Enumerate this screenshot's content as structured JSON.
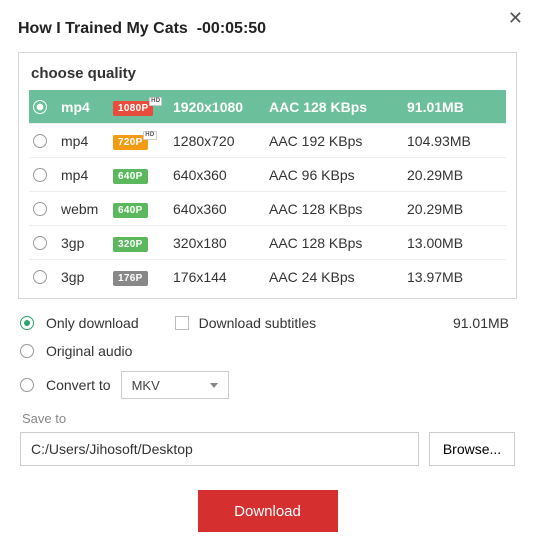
{
  "header": {
    "title": "How I Trained My Cats",
    "duration": "-00:05:50"
  },
  "quality": {
    "heading": "choose quality",
    "rows": [
      {
        "format": "mp4",
        "badge": "1080P",
        "badge_color": "red",
        "hd": true,
        "resolution": "1920x1080",
        "audio": "AAC 128 KBps",
        "size": "91.01MB",
        "selected": true
      },
      {
        "format": "mp4",
        "badge": "720P",
        "badge_color": "orange",
        "hd": true,
        "resolution": "1280x720",
        "audio": "AAC 192 KBps",
        "size": "104.93MB",
        "selected": false
      },
      {
        "format": "mp4",
        "badge": "640P",
        "badge_color": "green",
        "hd": false,
        "resolution": "640x360",
        "audio": "AAC 96 KBps",
        "size": "20.29MB",
        "selected": false
      },
      {
        "format": "webm",
        "badge": "640P",
        "badge_color": "green",
        "hd": false,
        "resolution": "640x360",
        "audio": "AAC 128 KBps",
        "size": "20.29MB",
        "selected": false
      },
      {
        "format": "3gp",
        "badge": "320P",
        "badge_color": "green",
        "hd": false,
        "resolution": "320x180",
        "audio": "AAC 128 KBps",
        "size": "13.00MB",
        "selected": false
      },
      {
        "format": "3gp",
        "badge": "176P",
        "badge_color": "gray",
        "hd": false,
        "resolution": "176x144",
        "audio": "AAC 24 KBps",
        "size": "13.97MB",
        "selected": false
      }
    ]
  },
  "options": {
    "only_download": "Only download",
    "download_subtitles": "Download subtitles",
    "selected_size": "91.01MB",
    "original_audio": "Original audio",
    "convert_to": "Convert to",
    "convert_value": "MKV"
  },
  "save": {
    "label": "Save to",
    "path": "C:/Users/Jihosoft/Desktop",
    "browse": "Browse..."
  },
  "actions": {
    "download": "Download"
  }
}
